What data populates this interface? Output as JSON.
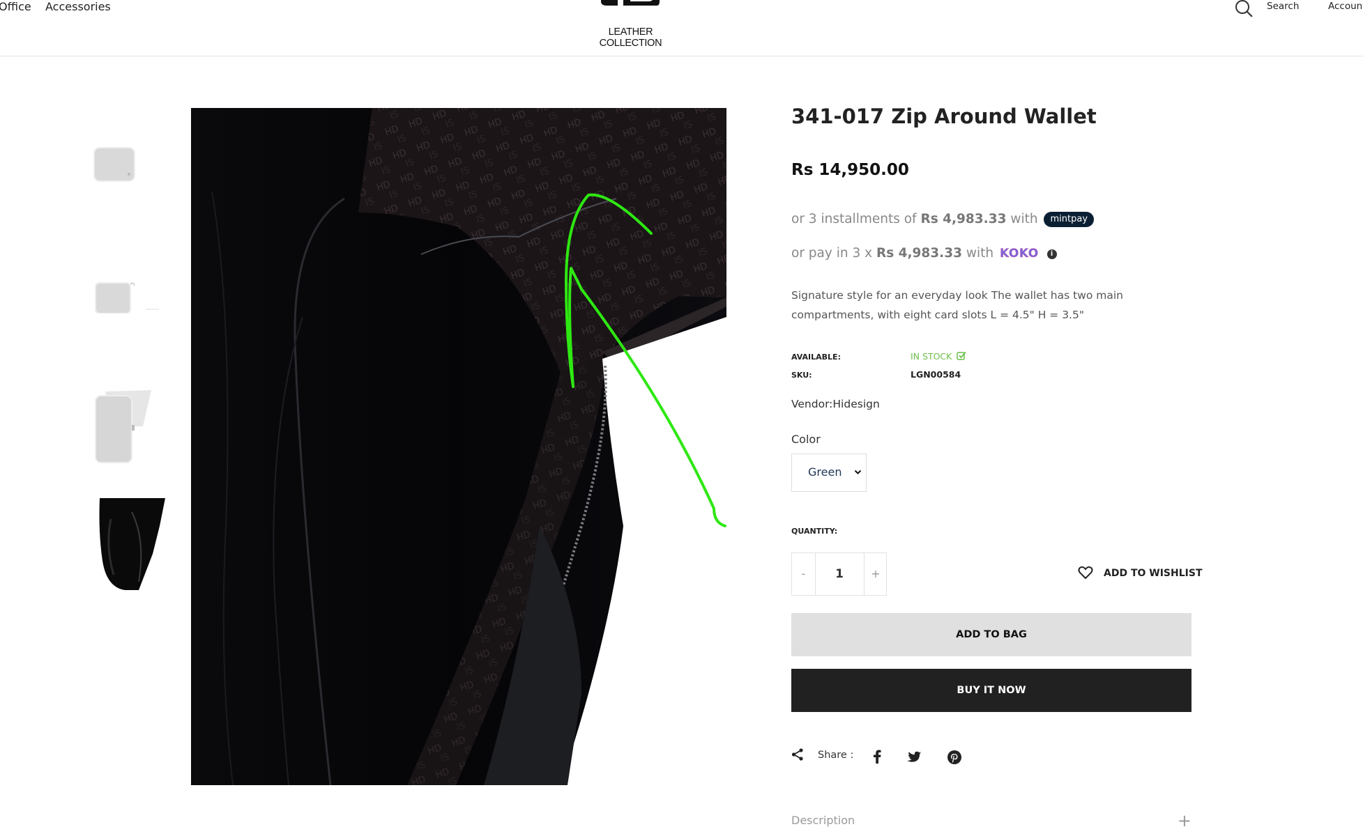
{
  "header": {
    "nav": [
      "Office",
      "Accessories"
    ],
    "logo_text": "LEATHER COLLECTION",
    "search_label": "Search",
    "account_label": "Account"
  },
  "product": {
    "title": "341-017 Zip Around Wallet",
    "price": "Rs 14,950.00",
    "installments": {
      "mintpay_prefix": "or 3 installments of",
      "mintpay_amount": "Rs 4,983.33",
      "mintpay_with": "with",
      "mintpay_brand": "mintpay",
      "koko_prefix": "or pay in 3 x",
      "koko_amount": "Rs 4,983.33",
      "koko_with": "with",
      "koko_brand": "KOKO"
    },
    "description": "Signature style for an everyday look The wallet has two main compartments, with eight card slots   L = 4.5\"  H = 3.5\"",
    "available_label": "AVAILABLE:",
    "available_value": "IN STOCK",
    "sku_label": "SKU:",
    "sku_value": "LGN00584",
    "vendor": "Vendor:Hidesign",
    "color_label": "Color",
    "color_value": "Green",
    "quantity_label": "QUANTITY:",
    "quantity_value": "1",
    "qty_minus": "-",
    "qty_plus": "+",
    "wishlist_label": "ADD TO WISHLIST",
    "add_to_bag": "ADD TO BAG",
    "buy_now": "BUY IT NOW",
    "share_label": "Share :",
    "accordion_description": "Description",
    "accordion_toggle": "+"
  },
  "colors": {
    "in_stock": "#6cbf4a",
    "annotation": "#2ee812",
    "buy_button": "#212121",
    "bag_button": "#e0e0e0"
  }
}
